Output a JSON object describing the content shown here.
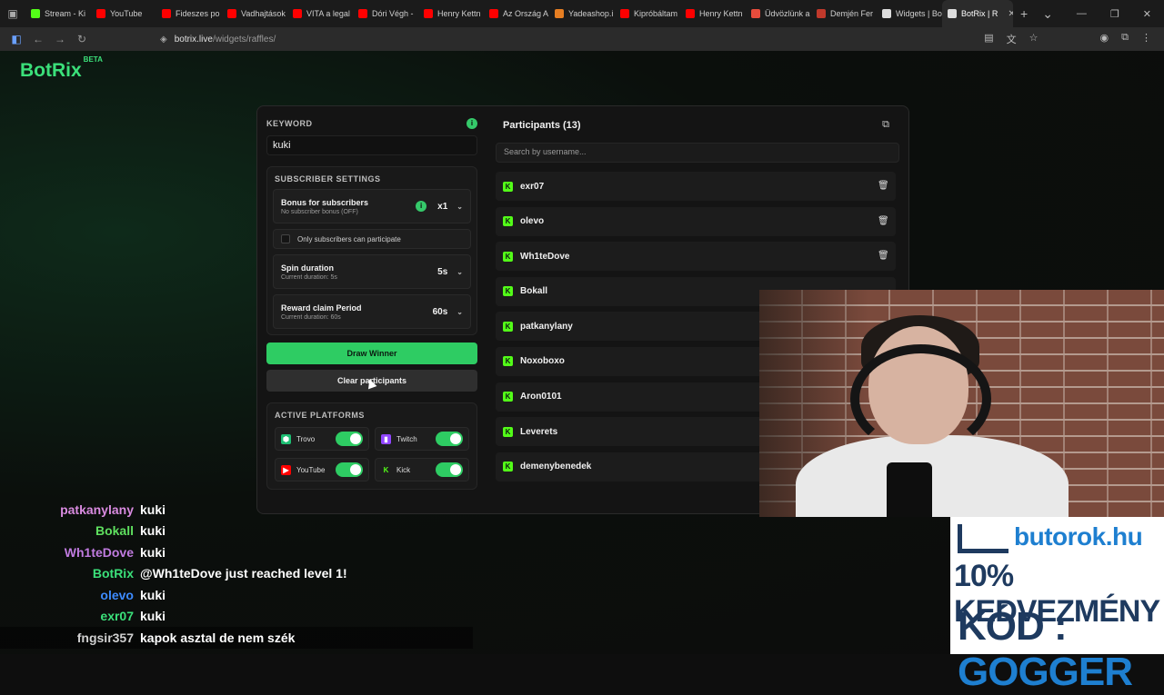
{
  "browser": {
    "tabs": [
      {
        "label": "Stream - Ki",
        "color": "#53fc18"
      },
      {
        "label": "YouTube",
        "color": "#ff0000"
      },
      {
        "label": "Fideszes po",
        "color": "#ff0000"
      },
      {
        "label": "Vadhajtások",
        "color": "#ff0000"
      },
      {
        "label": "VITA a legal",
        "color": "#ff0000"
      },
      {
        "label": "Dóri Végh -",
        "color": "#ff0000"
      },
      {
        "label": "Henry Kettn",
        "color": "#ff0000"
      },
      {
        "label": "Az Ország A",
        "color": "#ff0000"
      },
      {
        "label": "Yadeashop.i",
        "color": "#e67e22"
      },
      {
        "label": "Kipróbáltam",
        "color": "#ff0000"
      },
      {
        "label": "Henry Kettn",
        "color": "#ff0000"
      },
      {
        "label": "Üdvözlünk a",
        "color": "#e74c3c"
      },
      {
        "label": "Demjén Fer",
        "color": "#c0392b"
      },
      {
        "label": "Widgets | Bo",
        "color": "#dddddd"
      },
      {
        "label": "BotRix | R",
        "color": "#dddddd"
      }
    ],
    "url_host": "botrix.live",
    "url_path": "/widgets/raffles/"
  },
  "logo": {
    "text": "BotRix",
    "badge": "BETA"
  },
  "keyword": {
    "label": "KEYWORD",
    "value": "kuki",
    "info": "i"
  },
  "subscriber_settings": {
    "label": "SUBSCRIBER SETTINGS",
    "bonus": {
      "title": "Bonus for subscribers",
      "subtitle": "No subscriber bonus (OFF)",
      "value": "x1",
      "info": "i"
    },
    "only_subs": {
      "label": "Only subscribers can participate"
    },
    "spin": {
      "title": "Spin duration",
      "subtitle": "Current duration: 5s",
      "value": "5s"
    },
    "reward": {
      "title": "Reward claim Period",
      "subtitle": "Current duration: 60s",
      "value": "60s"
    }
  },
  "buttons": {
    "draw": "Draw Winner",
    "clear": "Clear participants"
  },
  "active_platforms": {
    "label": "ACTIVE PLATFORMS",
    "items": [
      {
        "name": "Trovo",
        "icon": "trovo-icon",
        "enabled": true
      },
      {
        "name": "Twitch",
        "icon": "twitch-icon",
        "enabled": true
      },
      {
        "name": "YouTube",
        "icon": "youtube-icon",
        "enabled": true
      },
      {
        "name": "Kick",
        "icon": "kick-icon",
        "enabled": true
      }
    ]
  },
  "participants": {
    "title": "Participants (13)",
    "search_placeholder": "Search by username...",
    "list": [
      "exr07",
      "olevo",
      "Wh1teDove",
      "Bokall",
      "patkanylany",
      "Noxoboxo",
      "Aron0101",
      "Leverets",
      "demenybenedek"
    ]
  },
  "chat": [
    {
      "user": "patkanylany",
      "color": "#d98be0",
      "msg": "kuki"
    },
    {
      "user": "Bokall",
      "color": "#5fe05f",
      "msg": "kuki"
    },
    {
      "user": "Wh1teDove",
      "color": "#c07be0",
      "msg": "kuki"
    },
    {
      "user": "BotRix",
      "color": "#3be07a",
      "msg": "@Wh1teDove just reached level 1!"
    },
    {
      "user": "olevo",
      "color": "#3d8bff",
      "msg": "kuki"
    },
    {
      "user": "exr07",
      "color": "#3be07a",
      "msg": "kuki"
    },
    {
      "user": "fngsir357",
      "color": "#d0d0d0",
      "msg": "kapok asztal de nem szék"
    }
  ],
  "ad": {
    "brand": "butorok.hu",
    "line2": "10% KEDVEZMÉNY",
    "line3_a": "KÓD : ",
    "line3_b": "GOGGER"
  }
}
